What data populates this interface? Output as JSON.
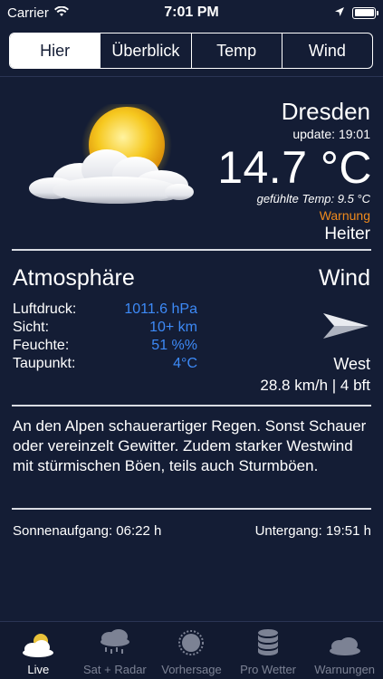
{
  "status_bar": {
    "carrier": "Carrier",
    "time": "7:01 PM"
  },
  "segments": [
    "Hier",
    "Überblick",
    "Temp",
    "Wind"
  ],
  "current": {
    "city": "Dresden",
    "update": "update: 19:01",
    "temperature": "14.7 °C",
    "feels_like": "gefühlte Temp: 9.5 °C",
    "warning": "Warnung",
    "condition": "Heiter"
  },
  "atmosphere": {
    "title": "Atmosphäre",
    "labels": [
      "Luftdruck:",
      "Sicht:",
      "Feuchte:",
      "Taupunkt:"
    ],
    "values": [
      "1011.6 hPa",
      "10+ km",
      "51 %%",
      "4°C"
    ]
  },
  "wind": {
    "title": "Wind",
    "direction": "West",
    "speed": "28.8 km/h | 4 bft"
  },
  "forecast_text": "An den Alpen schauerartiger Regen. Sonst Schauer oder vereinzelt Gewitter. Zudem starker Westwind mit stürmischen Böen, teils auch Sturmböen.",
  "sun": {
    "sunrise": "Sonnenaufgang: 06:22 h",
    "sunset": "Untergang: 19:51 h"
  },
  "tabs": [
    "Live",
    "Sat + Radar",
    "Vorhersage",
    "Pro Wetter",
    "Warnungen"
  ],
  "colors": {
    "background": "#141d35",
    "value_blue": "#3d8af7",
    "warning_orange": "#f08a1c"
  },
  "icons": [
    "wifi-icon",
    "location-arrow-icon",
    "battery-icon",
    "sun-cloud-icon",
    "wind-arrow-icon",
    "cloud-sun-tab-icon",
    "rain-cloud-icon",
    "sun-tab-icon",
    "database-icon",
    "cloud-icon"
  ]
}
